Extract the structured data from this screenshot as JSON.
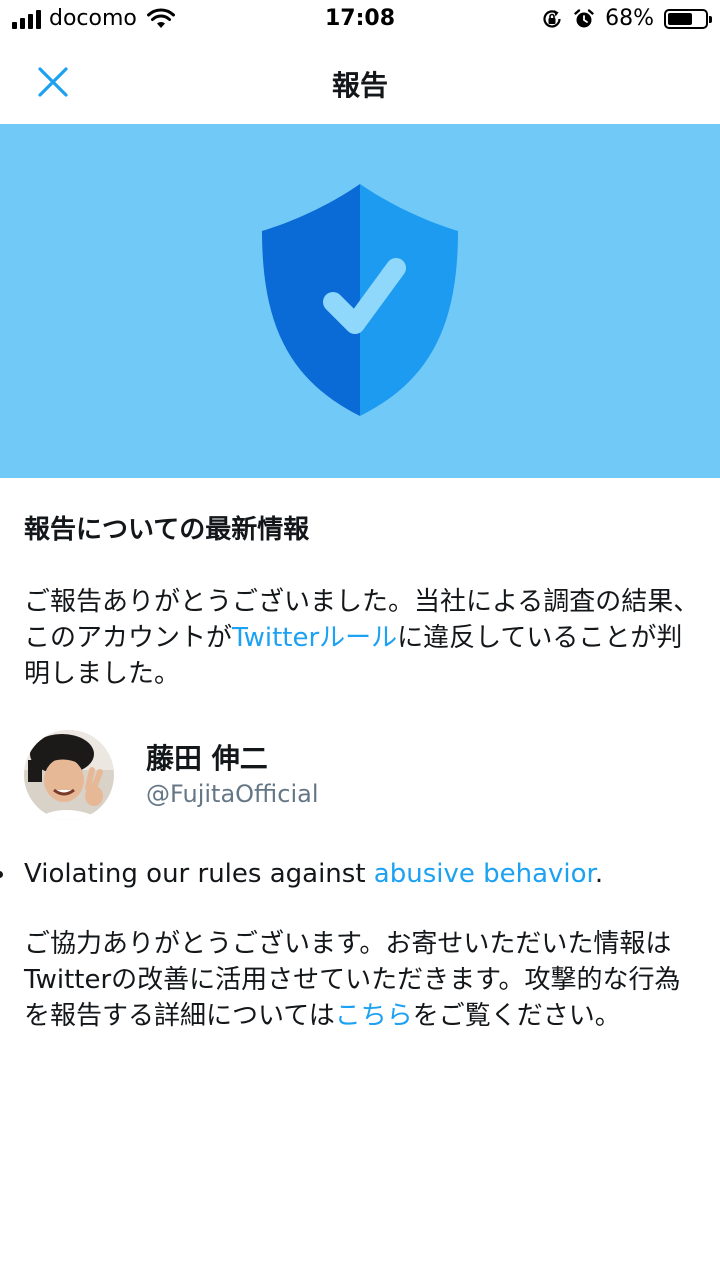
{
  "status_bar": {
    "carrier": "docomo",
    "time": "17:08",
    "battery_percent": "68%",
    "battery_level": 0.68,
    "icons": [
      "signal-icon",
      "wifi-icon",
      "orientation-lock-icon",
      "alarm-icon",
      "battery-icon"
    ]
  },
  "navbar": {
    "title": "報告",
    "close_icon": "close-icon"
  },
  "colors": {
    "accent": "#1da1f2",
    "hero_bg": "#71c9f8",
    "shield_dark": "#0a6bd6",
    "shield_light": "#1d9bf0",
    "check": "#8fd8fb"
  },
  "hero": {
    "icon": "shield-check-icon"
  },
  "report": {
    "heading": "報告についての最新情報",
    "para1_before": "ご報告ありがとうございました。当社による調査の結果、このアカウントが",
    "para1_link": "Twitterルール",
    "para1_after": "に違反していることが判明しました。"
  },
  "account": {
    "name": "藤田 伸二",
    "handle": "@FujitaOfficial"
  },
  "violation": {
    "text_before": "Violating our rules against ",
    "link": "abusive behavior",
    "text_after": "."
  },
  "thanks": {
    "text_before": "ご協力ありがとうございます。お寄せいただいた情報はTwitterの改善に活用させていただきます。攻撃的な行為を報告する詳細については",
    "link": "こちら",
    "text_after": "をご覧ください。"
  }
}
